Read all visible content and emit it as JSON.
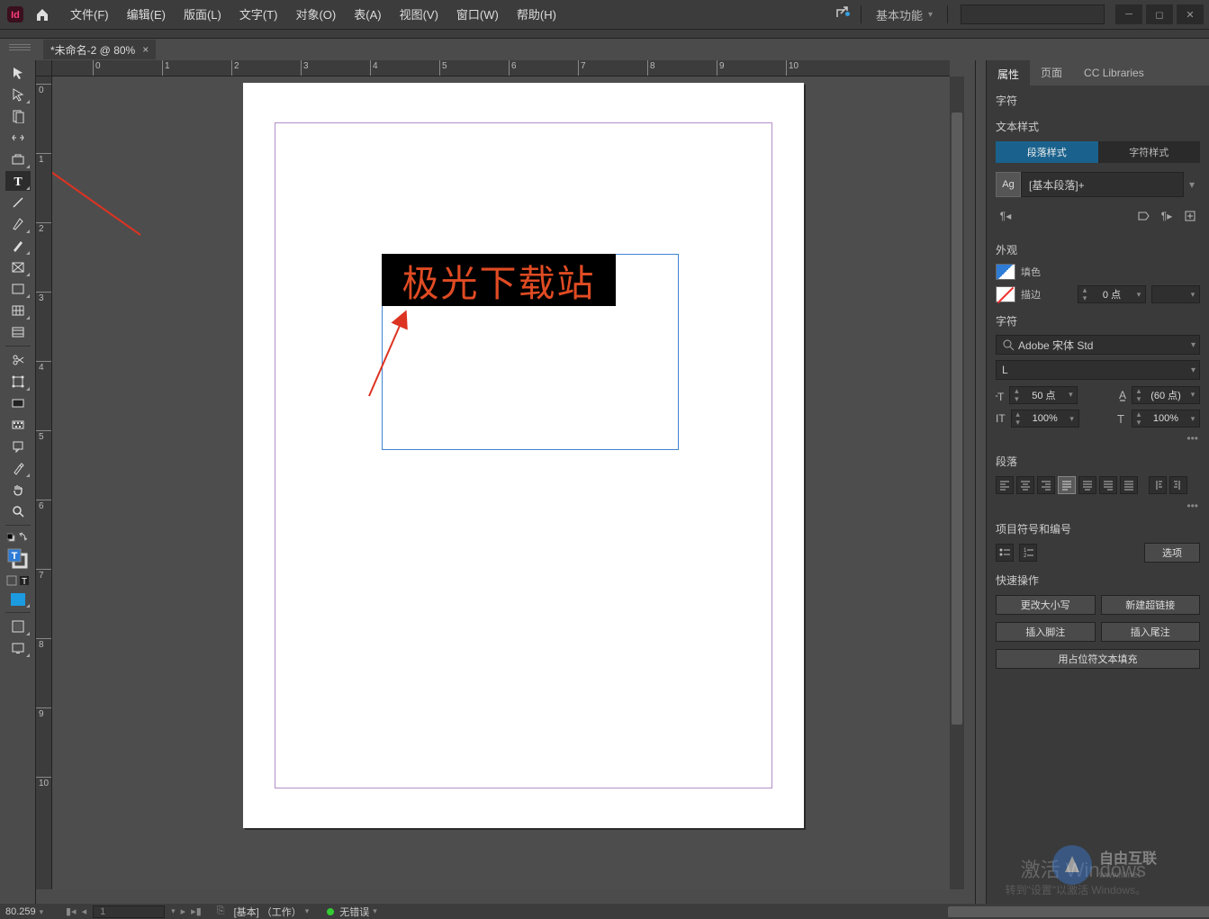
{
  "menu": {
    "file": "文件(F)",
    "edit": "编辑(E)",
    "layout": "版面(L)",
    "text": "文字(T)",
    "object": "对象(O)",
    "table": "表(A)",
    "view": "视图(V)",
    "window": "窗口(W)",
    "help": "帮助(H)"
  },
  "workspace_label": "基本功能",
  "tab": {
    "title": "*未命名-2 @ 80%",
    "close": "×"
  },
  "canvas": {
    "text": "极光下载站"
  },
  "ruler_h": [
    0,
    1,
    2,
    3,
    4,
    5,
    6,
    7,
    8,
    9,
    10
  ],
  "ruler_v": [
    0,
    1,
    2,
    3,
    4,
    5,
    6,
    7,
    8,
    9,
    10
  ],
  "status": {
    "zoom": "80.259",
    "page": "1",
    "layer": "[基本] （工作）",
    "error": "无错误"
  },
  "panel": {
    "tabs": {
      "props": "属性",
      "pages": "页面",
      "cc": "CC Libraries"
    },
    "char_section": "字符",
    "text_style": "文本样式",
    "para_style": "段落样式",
    "char_style": "字符样式",
    "style_value": "[基本段落]+",
    "appearance": "外观",
    "fill": "填色",
    "stroke": "描边",
    "stroke_val": "0 点",
    "font": "Adobe 宋体 Std",
    "font_weight": "L",
    "size": "50 点",
    "leading": "(60 点)",
    "hscale": "100%",
    "vscale": "100%",
    "paragraph": "段落",
    "bullets": "项目符号和编号",
    "options": "选项",
    "quick": "快速操作",
    "case": "更改大小写",
    "hyperlink": "新建超链接",
    "footnote": "插入脚注",
    "endnote": "插入尾注",
    "placeholder": "用占位符文本填充"
  },
  "watermark": {
    "t1": "激活 Windows",
    "t2": "转到\"设置\"以激活 Windows。"
  }
}
